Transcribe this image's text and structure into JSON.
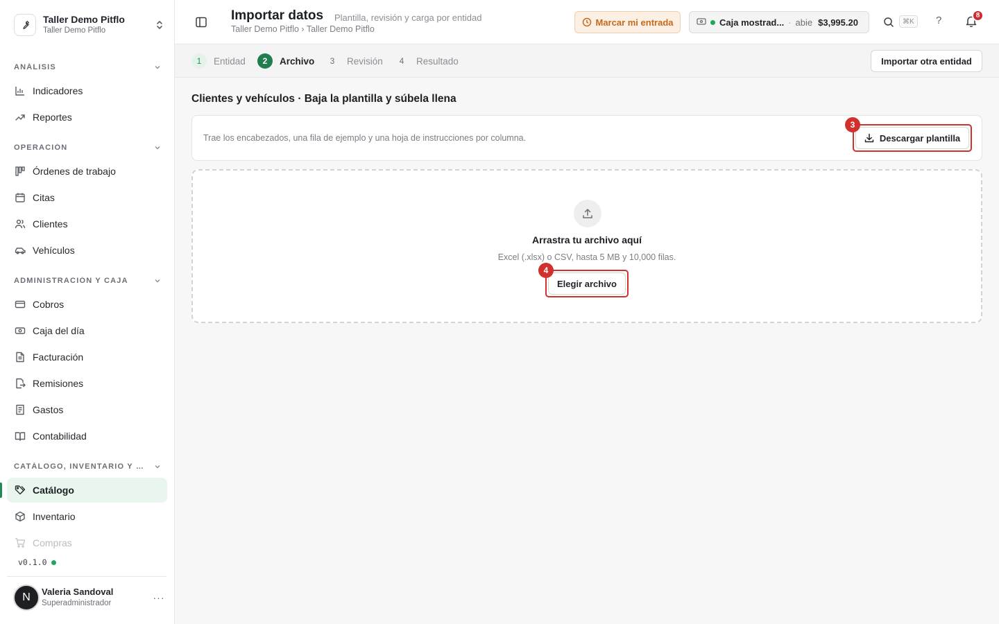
{
  "org": {
    "name": "Taller Demo Pitflo",
    "subtitle": "Taller Demo Pitflo"
  },
  "sidebar": {
    "sections": [
      {
        "label": "Análisis"
      },
      {
        "label": "Operación"
      },
      {
        "label": "Administración y caja"
      },
      {
        "label": "Catálogo, inventario y co..."
      }
    ],
    "items": [
      {
        "label": "Indicadores",
        "icon": "bar-chart-icon"
      },
      {
        "label": "Reportes",
        "icon": "trend-up-icon"
      },
      {
        "label": "Órdenes de trabajo",
        "icon": "kanban-icon"
      },
      {
        "label": "Citas",
        "icon": "calendar-icon"
      },
      {
        "label": "Clientes",
        "icon": "users-icon"
      },
      {
        "label": "Vehículos",
        "icon": "car-icon"
      },
      {
        "label": "Cobros",
        "icon": "credit-card-icon"
      },
      {
        "label": "Caja del día",
        "icon": "cash-icon"
      },
      {
        "label": "Facturación",
        "icon": "file-text-icon"
      },
      {
        "label": "Remisiones",
        "icon": "file-export-icon"
      },
      {
        "label": "Gastos",
        "icon": "receipt-icon"
      },
      {
        "label": "Contabilidad",
        "icon": "book-open-icon"
      },
      {
        "label": "Catálogo",
        "icon": "tags-icon"
      },
      {
        "label": "Inventario",
        "icon": "package-icon"
      },
      {
        "label": "Compras",
        "icon": "cart-icon"
      }
    ],
    "active_item": "Catálogo",
    "version": "v0.1.0"
  },
  "user": {
    "initial": "N",
    "name": "Valeria Sandoval",
    "role": "Superadministrador",
    "more": "···"
  },
  "header": {
    "title": "Importar datos",
    "subtitle": "Plantilla, revisión y carga por entidad",
    "breadcrumb": "Taller Demo Pitflo › Taller Demo Pitflo",
    "checkin_label": "Marcar mi entrada",
    "cashbox": {
      "name": "Caja mostrad...",
      "separator": "·",
      "status": "abie",
      "amount": "$3,995.20"
    },
    "search_shortcut": "⌘K",
    "help": "?",
    "notifications_count": "8"
  },
  "stepper": {
    "steps": [
      {
        "num": "1",
        "label": "Entidad",
        "state": "done"
      },
      {
        "num": "2",
        "label": "Archivo",
        "state": "current"
      },
      {
        "num": "3",
        "label": "Revisión",
        "state": "todo"
      },
      {
        "num": "4",
        "label": "Resultado",
        "state": "todo"
      }
    ],
    "import_other_label": "Importar otra entidad"
  },
  "main": {
    "section_title": "Clientes y vehículos · Baja la plantilla y súbela llena",
    "template_description": "Trae los encabezados, una fila de ejemplo y una hoja de instrucciones por columna.",
    "download_label": "Descargar plantilla",
    "dropzone": {
      "title": "Arrastra tu archivo aquí",
      "subtitle": "Excel (.xlsx) o CSV, hasta 5 MB y 10,000 filas.",
      "choose_label": "Elegir archivo"
    },
    "annotations": {
      "download": "3",
      "choose": "4"
    }
  },
  "colors": {
    "accent_green": "#1f7d4e",
    "active_bg": "#e9f6ee",
    "highlight_red": "#d2302c",
    "checkin_orange": "#c56a1d"
  }
}
